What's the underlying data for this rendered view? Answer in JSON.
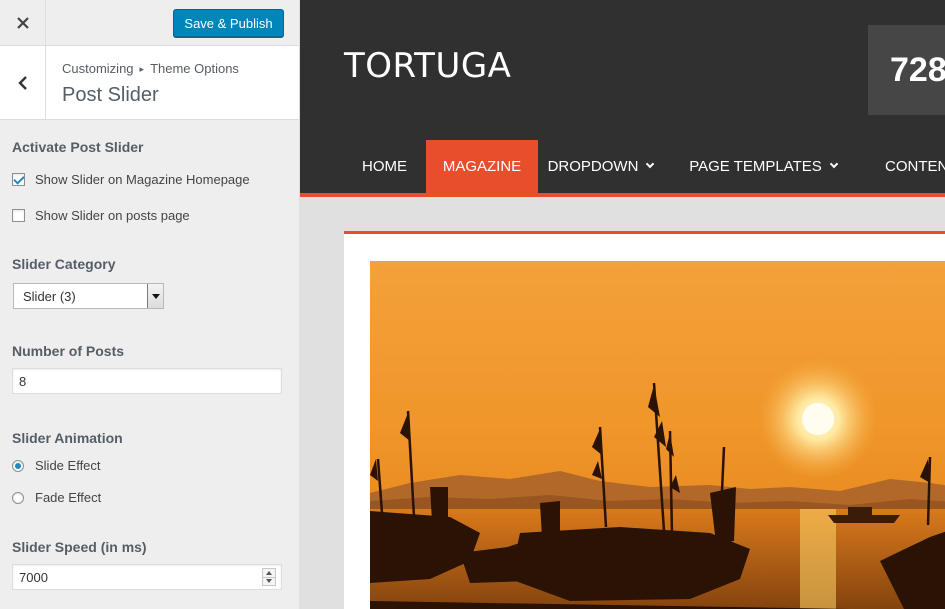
{
  "header": {
    "close_icon": "close-icon",
    "publish_label": "Save & Publish"
  },
  "section": {
    "breadcrumb_root": "Customizing",
    "breadcrumb_parent": "Theme Options",
    "title": "Post Slider"
  },
  "controls": {
    "activate": {
      "title": "Activate Post Slider",
      "magazine_label": "Show Slider on Magazine Homepage",
      "magazine_checked": true,
      "posts_label": "Show Slider on posts page",
      "posts_checked": false
    },
    "category": {
      "title": "Slider Category",
      "selected": "Slider (3)"
    },
    "number": {
      "title": "Number of Posts",
      "value": "8"
    },
    "animation": {
      "title": "Slider Animation",
      "options": [
        "Slide Effect",
        "Fade Effect"
      ],
      "selected": "Slide Effect"
    },
    "speed": {
      "title": "Slider Speed (in ms)",
      "value": "7000"
    }
  },
  "preview": {
    "site_title": "TORTUGA",
    "ad_text": "728",
    "nav": [
      "HOME",
      "MAGAZINE",
      "DROPDOWN",
      "PAGE TEMPLATES",
      "CONTENT"
    ],
    "active_nav": "MAGAZINE",
    "accent_color": "#e84e2c"
  },
  "colors": {
    "publish_button": "#0085ba",
    "header_dark": "#303030"
  }
}
